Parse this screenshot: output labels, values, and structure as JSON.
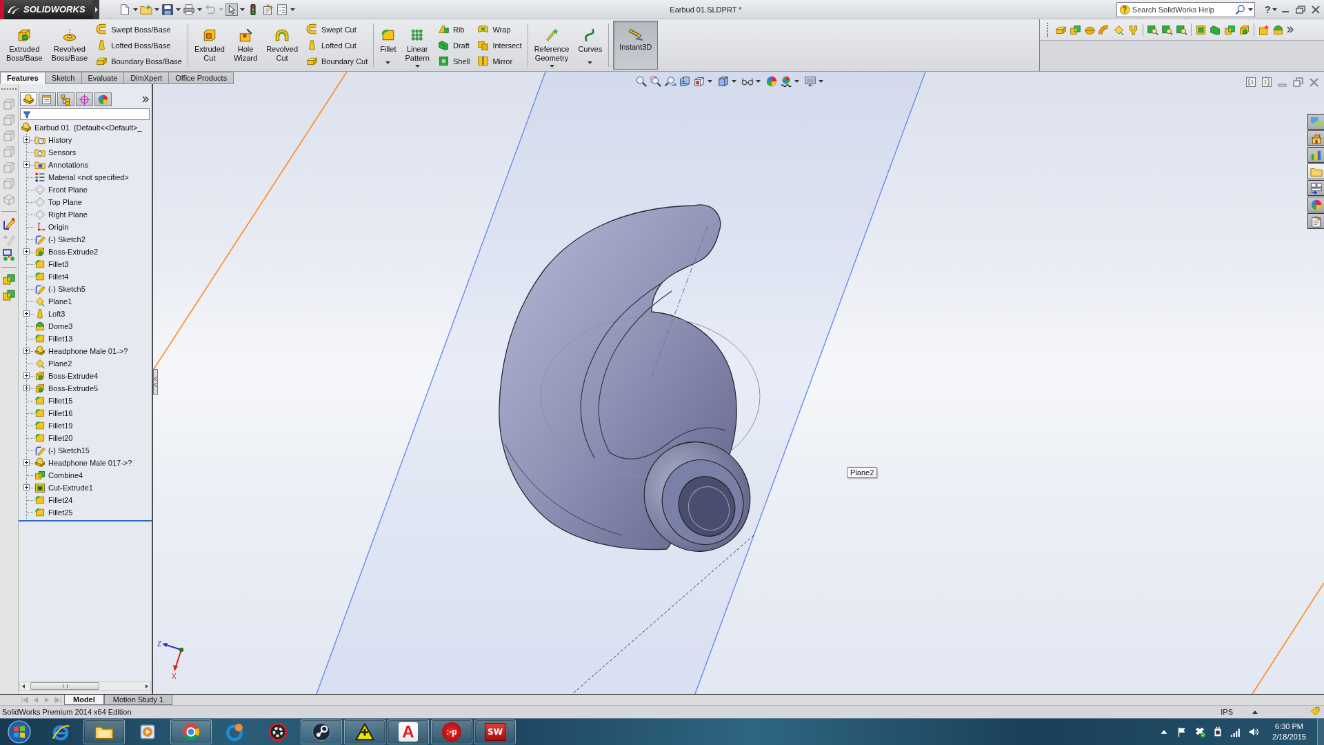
{
  "title_bar": {
    "logo": "SOLIDWORKS",
    "title": "Earbud 01.SLDPRT *",
    "search": {
      "placeholder": "Search SolidWorks Help"
    },
    "help": "?"
  },
  "command_manager": {
    "groups": [
      {
        "columns": [
          {
            "kind": "large",
            "label": "Extruded Boss/Base",
            "dropdown": false,
            "pressed": false
          },
          {
            "kind": "large",
            "label": "Revolved Boss/Base",
            "dropdown": false,
            "pressed": false
          },
          {
            "kind": "stack",
            "items": [
              {
                "label": "Swept Boss/Base"
              },
              {
                "label": "Lofted Boss/Base"
              },
              {
                "label": "Boundary Boss/Base"
              }
            ]
          }
        ]
      },
      {
        "columns": [
          {
            "kind": "large",
            "label": "Extruded Cut",
            "dropdown": false,
            "pressed": false
          },
          {
            "kind": "large",
            "label": "Hole Wizard",
            "dropdown": false,
            "pressed": false
          },
          {
            "kind": "large",
            "label": "Revolved Cut",
            "dropdown": false,
            "pressed": false
          },
          {
            "kind": "stack",
            "items": [
              {
                "label": "Swept Cut"
              },
              {
                "label": "Lofted Cut"
              },
              {
                "label": "Boundary Cut"
              }
            ]
          }
        ]
      },
      {
        "columns": [
          {
            "kind": "large",
            "label": "Fillet",
            "dropdown": true,
            "pressed": false
          },
          {
            "kind": "large",
            "label": "Linear Pattern",
            "dropdown": true,
            "pressed": false
          },
          {
            "kind": "stack",
            "items": [
              {
                "label": "Rib"
              },
              {
                "label": "Draft"
              },
              {
                "label": "Shell"
              }
            ]
          },
          {
            "kind": "stack",
            "items": [
              {
                "label": "Wrap"
              },
              {
                "label": "Intersect"
              },
              {
                "label": "Mirror"
              }
            ]
          }
        ]
      },
      {
        "columns": [
          {
            "kind": "large",
            "label": "Reference Geometry",
            "dropdown": true,
            "pressed": false
          },
          {
            "kind": "large",
            "label": "Curves",
            "dropdown": true,
            "pressed": false
          }
        ]
      },
      {
        "columns": [
          {
            "kind": "large",
            "label": "Instant3D",
            "dropdown": false,
            "pressed": true
          }
        ]
      }
    ]
  },
  "tabs": [
    {
      "label": "Features",
      "selected": true
    },
    {
      "label": "Sketch",
      "selected": false
    },
    {
      "label": "Evaluate",
      "selected": false
    },
    {
      "label": "DimXpert",
      "selected": false
    },
    {
      "label": "Office Products",
      "selected": false
    }
  ],
  "panel_tabs": [
    {
      "selected": true
    },
    {
      "selected": false
    },
    {
      "selected": false
    },
    {
      "selected": false
    },
    {
      "selected": false
    }
  ],
  "feature_tree": {
    "label": "Earbud 01  (Default<<Default>_",
    "kind": "part",
    "children": [
      {
        "label": "History",
        "kind": "history",
        "expandable": true
      },
      {
        "label": "Sensors",
        "kind": "sensors",
        "expandable": false
      },
      {
        "label": "Annotations",
        "kind": "annotations",
        "expandable": true
      },
      {
        "label": "Material <not specified>",
        "kind": "material",
        "expandable": false
      },
      {
        "label": "Front Plane",
        "kind": "plane",
        "expandable": false
      },
      {
        "label": "Top Plane",
        "kind": "plane",
        "expandable": false
      },
      {
        "label": "Right Plane",
        "kind": "plane",
        "expandable": false
      },
      {
        "label": "Origin",
        "kind": "origin",
        "expandable": false
      },
      {
        "label": "(-) Sketch2",
        "kind": "sketch",
        "expandable": false
      },
      {
        "label": "Boss-Extrude2",
        "kind": "extrude",
        "expandable": true
      },
      {
        "label": "Fillet3",
        "kind": "fillet",
        "expandable": false
      },
      {
        "label": "Fillet4",
        "kind": "fillet",
        "expandable": false
      },
      {
        "label": "(-) Sketch5",
        "kind": "sketch",
        "expandable": false
      },
      {
        "label": "Plane1",
        "kind": "ref_plane",
        "expandable": false
      },
      {
        "label": "Loft3",
        "kind": "loft",
        "expandable": true
      },
      {
        "label": "Dome3",
        "kind": "dome",
        "expandable": false
      },
      {
        "label": "Fillet13",
        "kind": "fillet",
        "expandable": false
      },
      {
        "label": "Headphone Male 01->?",
        "kind": "part",
        "expandable": true
      },
      {
        "label": "Plane2",
        "kind": "ref_plane",
        "expandable": false
      },
      {
        "label": "Boss-Extrude4",
        "kind": "extrude",
        "expandable": true
      },
      {
        "label": "Boss-Extrude5",
        "kind": "extrude",
        "expandable": true
      },
      {
        "label": "Fillet15",
        "kind": "fillet",
        "expandable": false
      },
      {
        "label": "Fillet16",
        "kind": "fillet",
        "expandable": false
      },
      {
        "label": "Fillet19",
        "kind": "fillet",
        "expandable": false
      },
      {
        "label": "Fillet20",
        "kind": "fillet",
        "expandable": false
      },
      {
        "label": "(-) Sketch15",
        "kind": "sketch",
        "expandable": false
      },
      {
        "label": "Headphone Male 017->?",
        "kind": "part",
        "expandable": true
      },
      {
        "label": "Combine4",
        "kind": "combine",
        "expandable": false
      },
      {
        "label": "Cut-Extrude1",
        "kind": "cut",
        "expandable": true
      },
      {
        "label": "Fillet24",
        "kind": "fillet",
        "expandable": false
      },
      {
        "label": "Fillet25",
        "kind": "fillet",
        "expandable": false
      }
    ]
  },
  "viewport": {
    "tooltip": "Plane2",
    "triad": {
      "z_label": "Z",
      "x_label": "X"
    }
  },
  "bottom_tabs": [
    {
      "label": "Model",
      "selected": true
    },
    {
      "label": "Motion Study 1",
      "selected": false
    }
  ],
  "status_bar": {
    "text": "SolidWorks Premium 2014 x64 Edition",
    "units": "IPS"
  },
  "taskbar": {
    "apps": [
      {
        "running": false
      },
      {
        "running": true
      },
      {
        "running": false
      },
      {
        "running": true
      },
      {
        "running": false
      },
      {
        "running": false
      },
      {
        "running": true
      },
      {
        "running": true
      },
      {
        "running": true,
        "glyph": "A"
      },
      {
        "running": true,
        "glyph": ":-p"
      },
      {
        "running": true,
        "glyph": "SW"
      }
    ],
    "clock": {
      "time": "6:30 PM",
      "date": "2/18/2015"
    }
  }
}
